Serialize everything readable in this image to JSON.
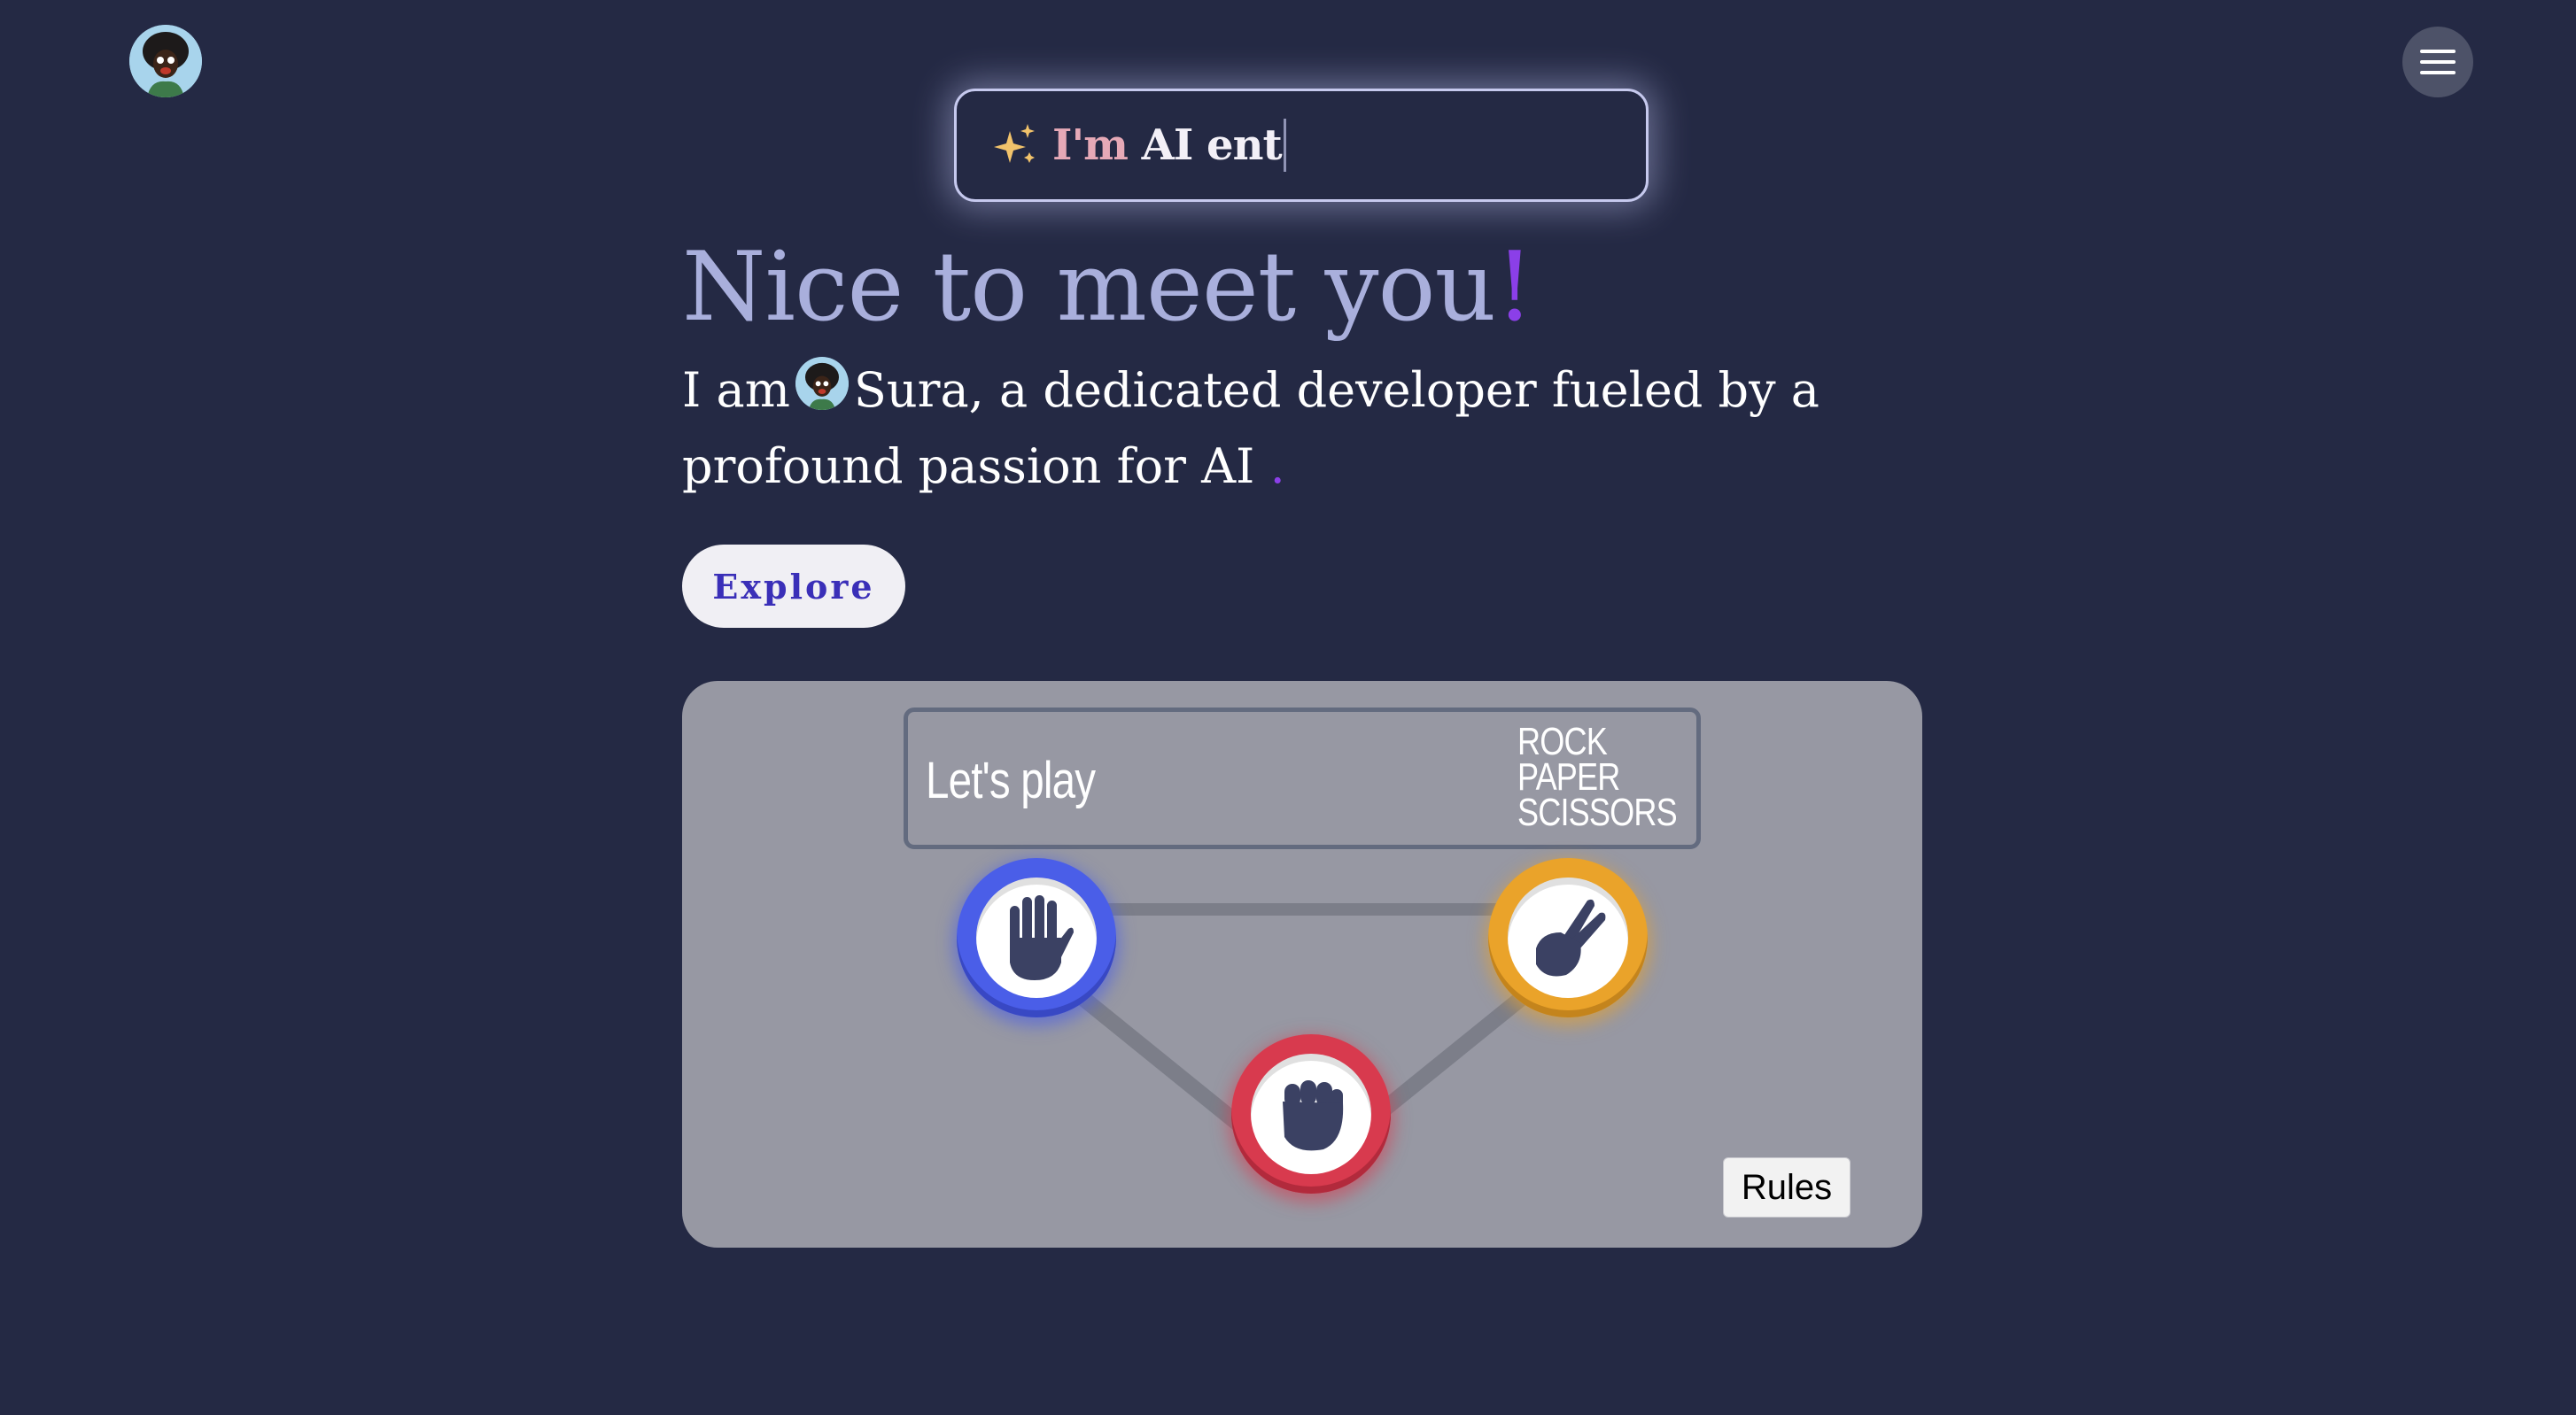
{
  "header": {
    "avatar_icon": "cartoon-avatar-icon",
    "menu_icon": "hamburger-menu-icon"
  },
  "typing": {
    "icon": "sparkles-icon",
    "text_part1": "I'm",
    "text_part2": " AI ent"
  },
  "hero": {
    "title": "Nice to meet you",
    "title_accent": "!",
    "intro_prefix": "I am",
    "intro_name_and_rest": "Sura, a dedicated developer fueled by a profound passion for AI",
    "intro_dot": ".",
    "explore_label": "Explore"
  },
  "game": {
    "score_label": "Let's play",
    "logo": [
      "ROCK",
      "PAPER",
      "SCISSORS"
    ],
    "tokens": {
      "paper_icon": "paper-hand-icon",
      "scissors_icon": "scissors-hand-icon",
      "rock_icon": "rock-fist-icon"
    },
    "rules_label": "Rules"
  },
  "colors": {
    "background": "#242944",
    "accent_purple": "#8b3fe8",
    "paper_blue": "#4a5ee8",
    "scissors_orange": "#eaa32a",
    "rock_red": "#d83a4e",
    "card_gray": "#9798a3"
  }
}
